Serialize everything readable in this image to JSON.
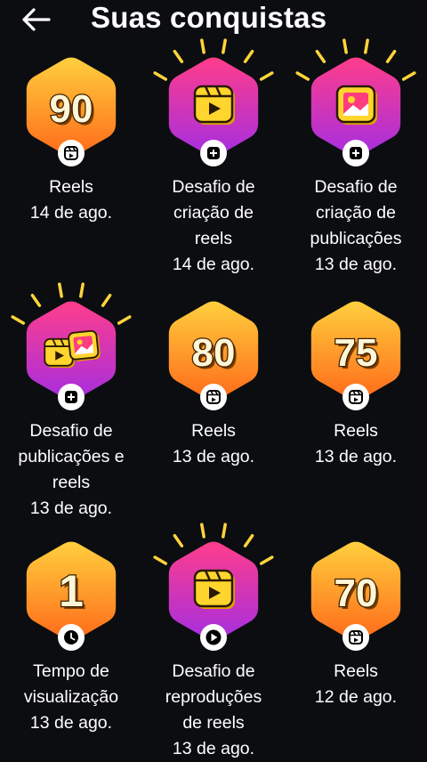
{
  "header": {
    "title": "Suas conquistas",
    "back_icon": "arrow-left-icon"
  },
  "colors": {
    "background": "#0b0d10",
    "badge_orange_top": "#ffcf3d",
    "badge_orange_bottom": "#ff6a1a",
    "badge_pink_top": "#ff3d8b",
    "badge_pink_bottom": "#a52ee0"
  },
  "badges": [
    {
      "lines": [
        "Reels",
        "14 de ago."
      ],
      "number": "90",
      "type": "number",
      "sub_icon": "reels-icon"
    },
    {
      "lines": [
        "Desafio de",
        "criação de",
        "reels",
        "14 de ago."
      ],
      "type": "challenge-reel",
      "sub_icon": "plus-icon"
    },
    {
      "lines": [
        "Desafio de",
        "criação de",
        "publicações",
        "13 de ago."
      ],
      "type": "challenge-photo",
      "sub_icon": "plus-icon"
    },
    {
      "lines": [
        "Desafio de",
        "publicações e",
        "reels",
        "13 de ago."
      ],
      "type": "challenge-both",
      "sub_icon": "plus-icon"
    },
    {
      "lines": [
        "Reels",
        "13 de ago."
      ],
      "number": "80",
      "type": "number",
      "sub_icon": "reels-icon"
    },
    {
      "lines": [
        "Reels",
        "13 de ago."
      ],
      "number": "75",
      "type": "number",
      "sub_icon": "reels-icon"
    },
    {
      "lines": [
        "Tempo de",
        "visualização",
        "13 de ago."
      ],
      "number": "1",
      "type": "number",
      "sub_icon": "clock-icon"
    },
    {
      "lines": [
        "Desafio de",
        "reproduções",
        "de reels",
        "13 de ago."
      ],
      "type": "challenge-reel",
      "sub_icon": "play-icon"
    },
    {
      "lines": [
        "Reels",
        "12 de ago."
      ],
      "number": "70",
      "type": "number",
      "sub_icon": "reels-icon"
    }
  ]
}
